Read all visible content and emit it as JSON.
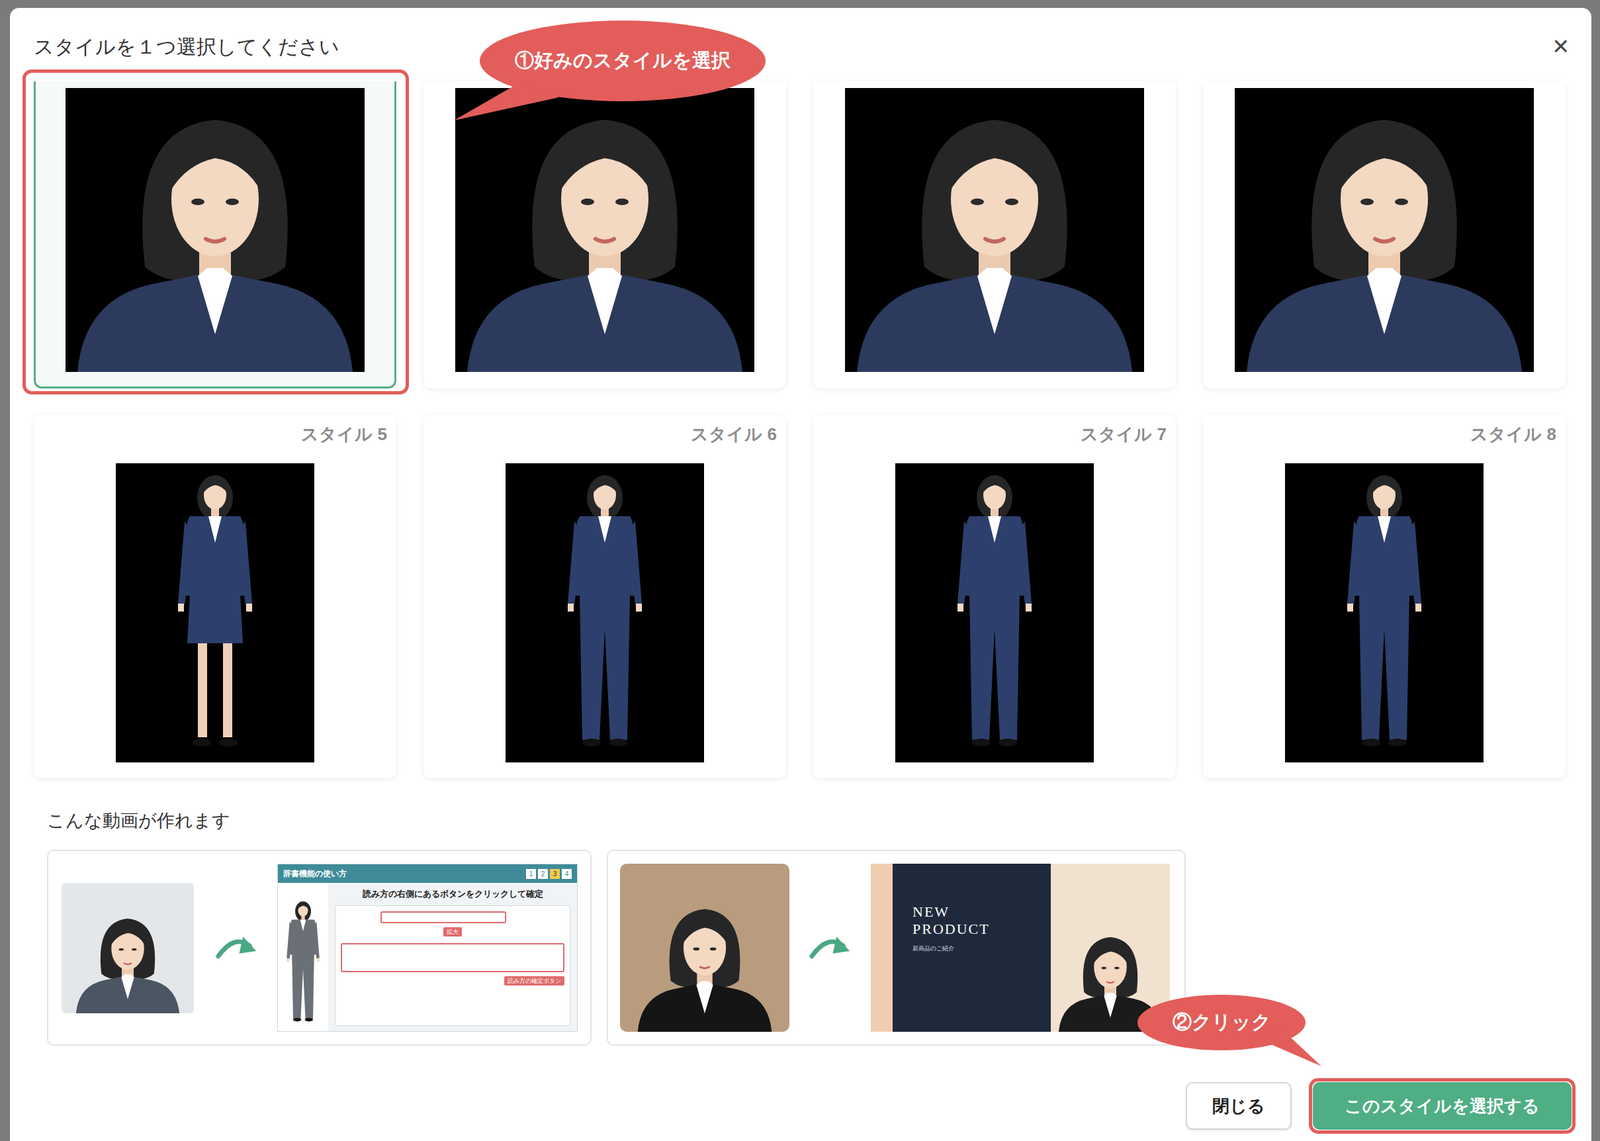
{
  "dialog": {
    "title": "スタイルを１つ選択してください",
    "close": "×"
  },
  "styles": [
    {
      "kind": "bust",
      "selected": true
    },
    {
      "kind": "bust",
      "selected": false
    },
    {
      "kind": "bust",
      "selected": false
    },
    {
      "kind": "bust",
      "selected": false
    },
    {
      "label": "スタイル 5",
      "kind": "skirt",
      "selected": false
    },
    {
      "label": "スタイル 6",
      "kind": "pants",
      "selected": false
    },
    {
      "label": "スタイル 7",
      "kind": "pants",
      "selected": false
    },
    {
      "label": "スタイル 8",
      "kind": "pants",
      "selected": false
    }
  ],
  "examples_title": "こんな動画が作れます",
  "examples": [
    {
      "kind": "manual",
      "screen": {
        "title": "辞書機能の使い方",
        "steps": [
          {
            "label": "1",
            "selected": false
          },
          {
            "label": "2",
            "selected": false
          },
          {
            "label": "3",
            "selected": true
          },
          {
            "label": "4",
            "selected": false
          }
        ],
        "heading": "読み方の右側にあるボタンをクリックして確定",
        "zoom_badge": "拡大",
        "button_badge": "読み方の確定ボタン"
      }
    },
    {
      "kind": "product",
      "slide": {
        "title": "NEW PRODUCT",
        "subtitle": "新商品のご紹介"
      }
    }
  ],
  "buttons": [
    {
      "label": "閉じる",
      "kind": "secondary"
    },
    {
      "label": "このスタイルを選択する",
      "kind": "primary"
    }
  ],
  "annotations": [
    {
      "text": "①好みのスタイルを選択"
    },
    {
      "text": "②クリック"
    }
  ]
}
